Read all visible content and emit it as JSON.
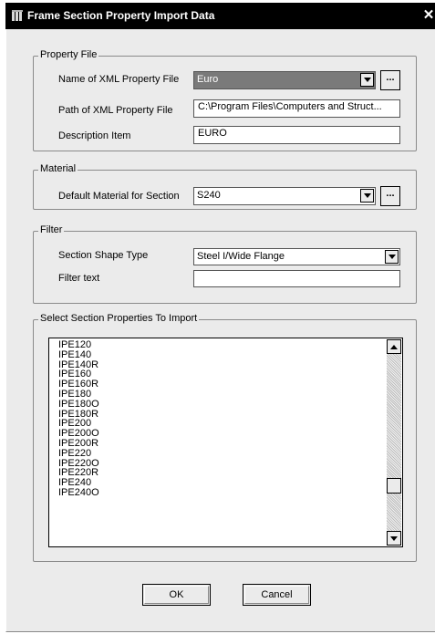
{
  "window": {
    "title": "Frame Section Property Import Data"
  },
  "property_file": {
    "group_label": "Property File",
    "name_label": "Name of XML Property File",
    "name_value": "Euro",
    "path_label": "Path of XML Property File",
    "path_value": "C:\\Program Files\\Computers and Struct...",
    "desc_label": "Description Item",
    "desc_value": "EURO",
    "browse_label": "..."
  },
  "material": {
    "group_label": "Material",
    "default_label": "Default Material for Section",
    "default_value": "S240",
    "browse_label": "..."
  },
  "filter": {
    "group_label": "Filter",
    "shape_label": "Section Shape Type",
    "shape_value": "Steel I/Wide Flange",
    "text_label": "Filter text",
    "text_value": ""
  },
  "section_list": {
    "group_label": "Select Section Properties To Import",
    "items": [
      "IPE120",
      "IPE140",
      "IPE140R",
      "IPE160",
      "IPE160R",
      "IPE180",
      "IPE180O",
      "IPE180R",
      "IPE200",
      "IPE200O",
      "IPE200R",
      "IPE220",
      "IPE220O",
      "IPE220R",
      "IPE240",
      "IPE240O"
    ]
  },
  "buttons": {
    "ok": "OK",
    "cancel": "Cancel"
  }
}
